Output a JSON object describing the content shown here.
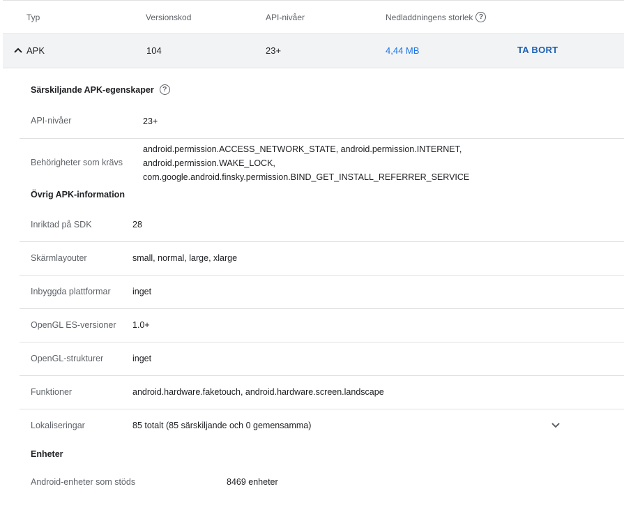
{
  "table_header": {
    "type": "Typ",
    "version_code": "Versionskod",
    "api_levels": "API-nivåer",
    "download_size": "Nedladdningens storlek"
  },
  "apk": {
    "type": "APK",
    "version_code": "104",
    "api_levels": "23+",
    "download_size": "4,44 MB",
    "remove_label": "TA BORT"
  },
  "distinct": {
    "title": "Särskiljande APK-egenskaper",
    "api_label": "API-nivåer",
    "api_value": "23+",
    "permissions_label": "Behörigheter som krävs",
    "permissions_line1": "android.permission.ACCESS_NETWORK_STATE, android.permission.INTERNET,",
    "permissions_line2": "android.permission.WAKE_LOCK,",
    "permissions_line3": "com.google.android.finsky.permission.BIND_GET_INSTALL_REFERRER_SERVICE"
  },
  "other": {
    "title": "Övrig APK-information",
    "rows": [
      {
        "label": "Inriktad på SDK",
        "value": "28"
      },
      {
        "label": "Skärmlayouter",
        "value": "small, normal, large, xlarge"
      },
      {
        "label": "Inbyggda plattformar",
        "value": "inget"
      },
      {
        "label": "OpenGL ES-versioner",
        "value": "1.0+"
      },
      {
        "label": "OpenGL-strukturer",
        "value": "inget"
      },
      {
        "label": "Funktioner",
        "value": "android.hardware.faketouch, android.hardware.screen.landscape"
      },
      {
        "label": "Lokaliseringar",
        "value": "85 totalt (85 särskiljande och 0 gemensamma)"
      }
    ]
  },
  "devices": {
    "title": "Enheter",
    "supported_label": "Android-enheter som stöds",
    "supported_value": "8469 enheter"
  },
  "icons": {
    "help": "help-circle-icon",
    "collapse": "chevron-up-icon",
    "expand": "chevron-down-icon"
  }
}
